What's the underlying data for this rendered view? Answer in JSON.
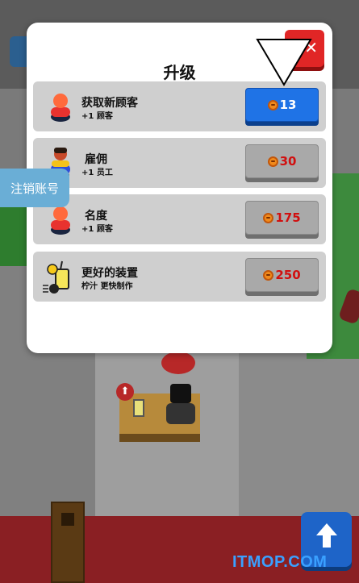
{
  "modal": {
    "title": "升级",
    "close_label": "✕"
  },
  "upgrades": [
    {
      "title": "获取新顾客",
      "subtitle": "+1 顾客",
      "price": "13",
      "icon": "customer-icon",
      "active": true
    },
    {
      "title": "雇佣",
      "subtitle": "+1 员工",
      "price": "30",
      "icon": "worker-icon",
      "active": false
    },
    {
      "title": "名度",
      "subtitle": "+1 顾客",
      "price": "175",
      "icon": "customer-icon",
      "active": false
    },
    {
      "title": "更好的装置",
      "subtitle": "柠汁 更快制作",
      "price": "250",
      "icon": "lemonade-machine-icon",
      "active": false
    }
  ],
  "side_tab": {
    "label": "注销账号"
  },
  "up_button": {
    "icon": "up-arrow-icon"
  },
  "watermark": "ITMOP.COM",
  "colors": {
    "active_button": "#1f73e6",
    "inactive_button": "#a9a9a9",
    "price_text": "#d10f0f",
    "close_button": "#e12626",
    "coin": "#f08a1c"
  }
}
